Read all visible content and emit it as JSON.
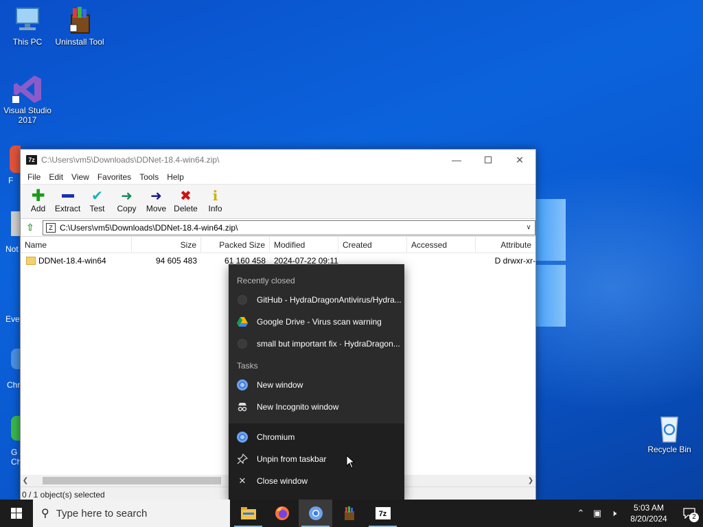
{
  "desktop": {
    "icons": [
      {
        "label": "This PC"
      },
      {
        "label": "Uninstall Tool"
      },
      {
        "label": "Visual Studio 2017"
      },
      {
        "label": "Recycle Bin"
      }
    ],
    "partial_labels": [
      "F",
      "Not",
      "Eve",
      "Chr",
      "G\nCh"
    ]
  },
  "sevenzip": {
    "app_icon_text": "7z",
    "title": "C:\\Users\\vm5\\Downloads\\DDNet-18.4-win64.zip\\",
    "menu": [
      "File",
      "Edit",
      "View",
      "Favorites",
      "Tools",
      "Help"
    ],
    "toolbar": [
      {
        "label": "Add",
        "icon": "plus-icon",
        "color": "#1a9b1a"
      },
      {
        "label": "Extract",
        "icon": "minus-icon",
        "color": "#1c2fb8"
      },
      {
        "label": "Test",
        "icon": "check-icon",
        "color": "#1ab0b8"
      },
      {
        "label": "Copy",
        "icon": "arrow-double-icon",
        "color": "#1a8a5a"
      },
      {
        "label": "Move",
        "icon": "arrow-right-icon",
        "color": "#1c1c8c"
      },
      {
        "label": "Delete",
        "icon": "x-icon",
        "color": "#d01010"
      },
      {
        "label": "Info",
        "icon": "info-icon",
        "color": "#c8b400"
      }
    ],
    "address": "C:\\Users\\vm5\\Downloads\\DDNet-18.4-win64.zip\\",
    "columns": [
      "Name",
      "Size",
      "Packed Size",
      "Modified",
      "Created",
      "Accessed",
      "Attribute"
    ],
    "rows": [
      {
        "name": "DDNet-18.4-win64",
        "size": "94 605 483",
        "packed": "61 160 458",
        "modified": "2024-07-22 09:11",
        "created": "",
        "accessed": "",
        "attributes": "D drwxr-xr-"
      }
    ],
    "status": "0 / 1 object(s) selected"
  },
  "jumplist": {
    "recent_header": "Recently closed",
    "recent": [
      {
        "label": "GitHub - HydraDragonAntivirus/Hydra...",
        "icon": "github-icon"
      },
      {
        "label": "Google Drive - Virus scan warning",
        "icon": "google-drive-icon"
      },
      {
        "label": "small but important fix · HydraDragon...",
        "icon": "github-icon"
      }
    ],
    "tasks_header": "Tasks",
    "tasks": [
      {
        "label": "New window",
        "icon": "chromium-icon"
      },
      {
        "label": "New Incognito window",
        "icon": "incognito-icon"
      }
    ],
    "pinned": [
      {
        "label": "Chromium",
        "icon": "chromium-icon"
      },
      {
        "label": "Unpin from taskbar",
        "icon": "unpin-icon"
      },
      {
        "label": "Close window",
        "icon": "close-icon"
      }
    ]
  },
  "taskbar": {
    "search_placeholder": "Type here to search",
    "time": "5:03 AM",
    "date": "8/20/2024",
    "notification_count": "2"
  }
}
